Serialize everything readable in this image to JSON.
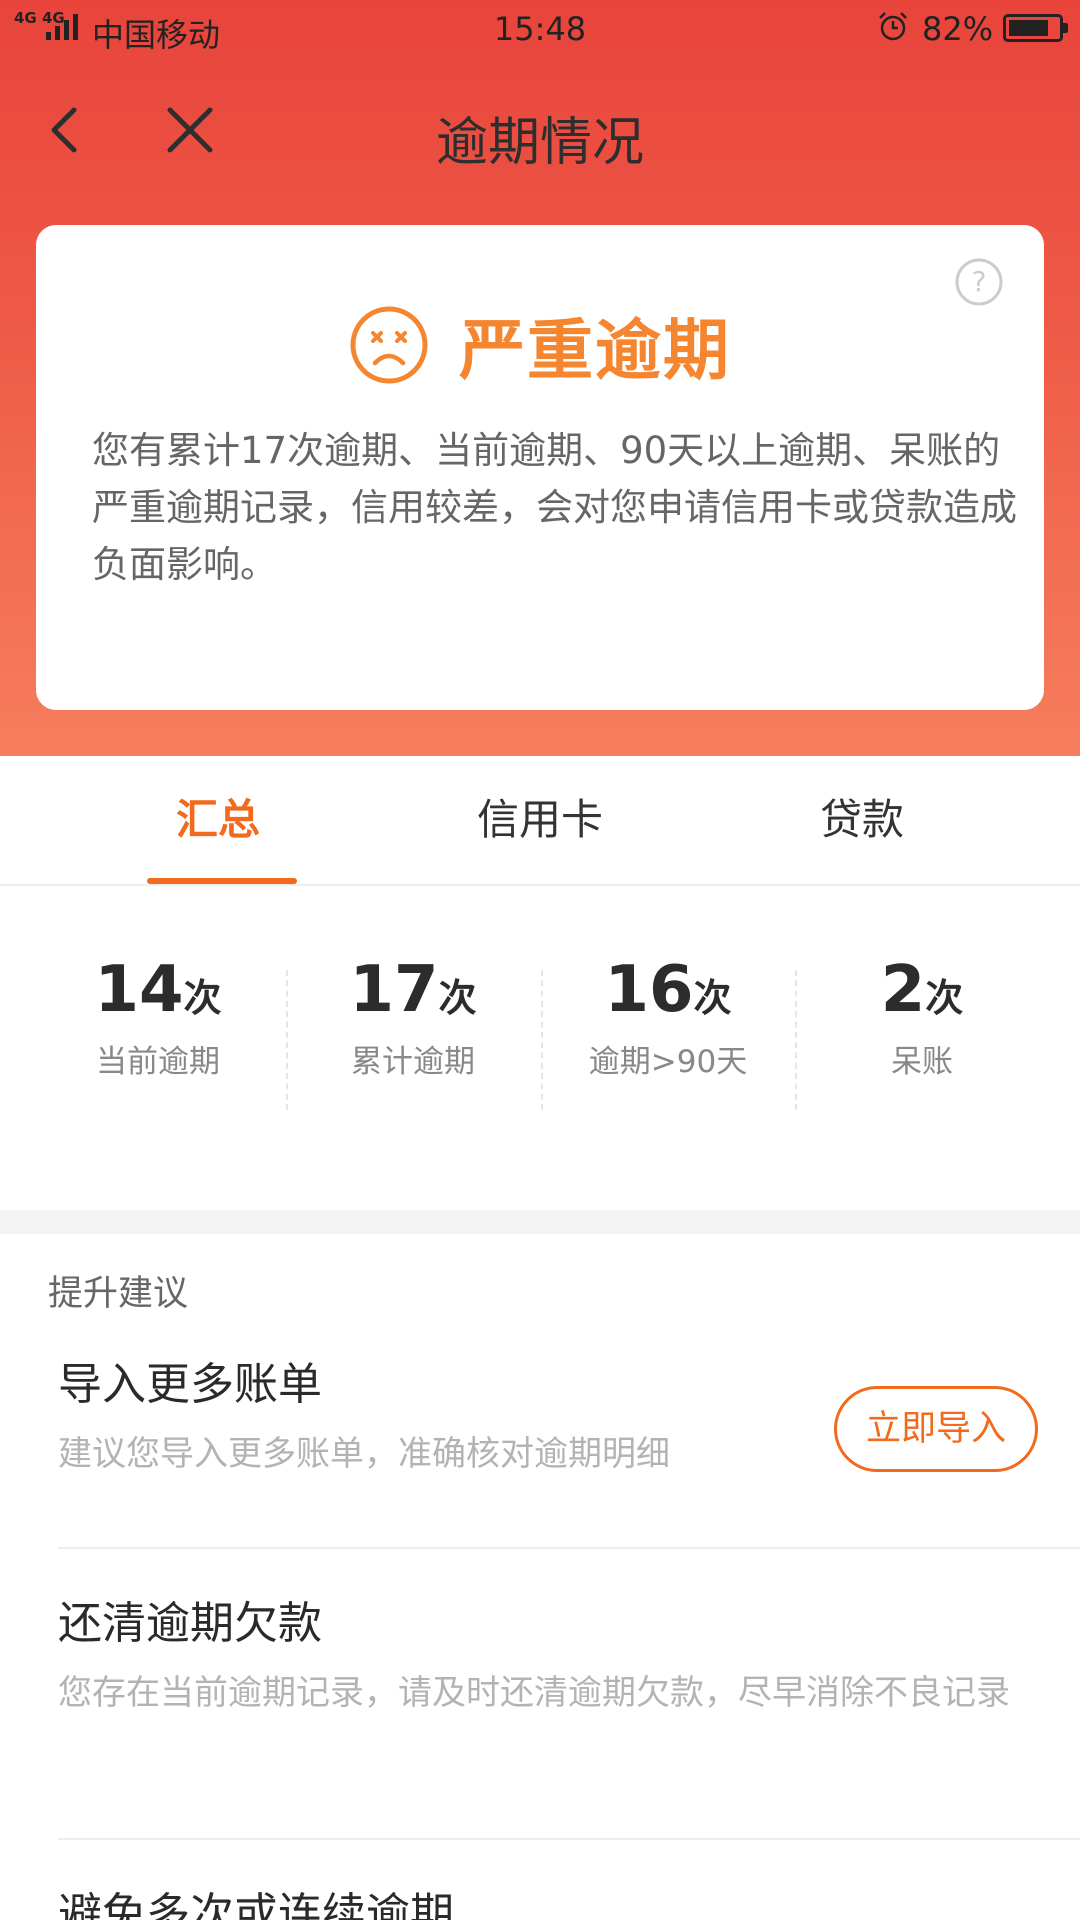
{
  "status_bar": {
    "network": "4G 4G",
    "carrier": "中国移动",
    "time": "15:48",
    "battery": "82%",
    "battery_level": 0.82
  },
  "nav": {
    "title": "逾期情况",
    "back_icon": "chevron-left-icon",
    "close_icon": "close-icon"
  },
  "summary_card": {
    "status_icon": "sad-face-icon",
    "status_title": "严重逾期",
    "description": "您有累计17次逾期、当前逾期、90天以上逾期、呆账的严重逾期记录，信用较差，会对您申请信用卡或贷款造成负面影响。",
    "help_icon": "question-circle-icon"
  },
  "tabs": [
    {
      "label": "汇总",
      "active": true
    },
    {
      "label": "信用卡",
      "active": false
    },
    {
      "label": "贷款",
      "active": false
    }
  ],
  "stats": [
    {
      "value": "14",
      "unit": "次",
      "label": "当前逾期"
    },
    {
      "value": "17",
      "unit": "次",
      "label": "累计逾期"
    },
    {
      "value": "16",
      "unit": "次",
      "label": "逾期>90天"
    },
    {
      "value": "2",
      "unit": "次",
      "label": "呆账"
    }
  ],
  "suggestions": {
    "section_title": "提升建议",
    "items": [
      {
        "title": "导入更多账单",
        "desc": "建议您导入更多账单，准确核对逾期明细",
        "button": "立即导入"
      },
      {
        "title": "还清逾期欠款",
        "desc": "您存在当前逾期记录，请及时还清逾期欠款，尽早消除不良记录"
      },
      {
        "title": "避免多次或连续逾期"
      }
    ]
  },
  "colors": {
    "accent": "#f26a1b",
    "status_orange": "#f5852f",
    "header_gradient_top": "#e8443c",
    "header_gradient_bottom": "#f67e5d"
  }
}
